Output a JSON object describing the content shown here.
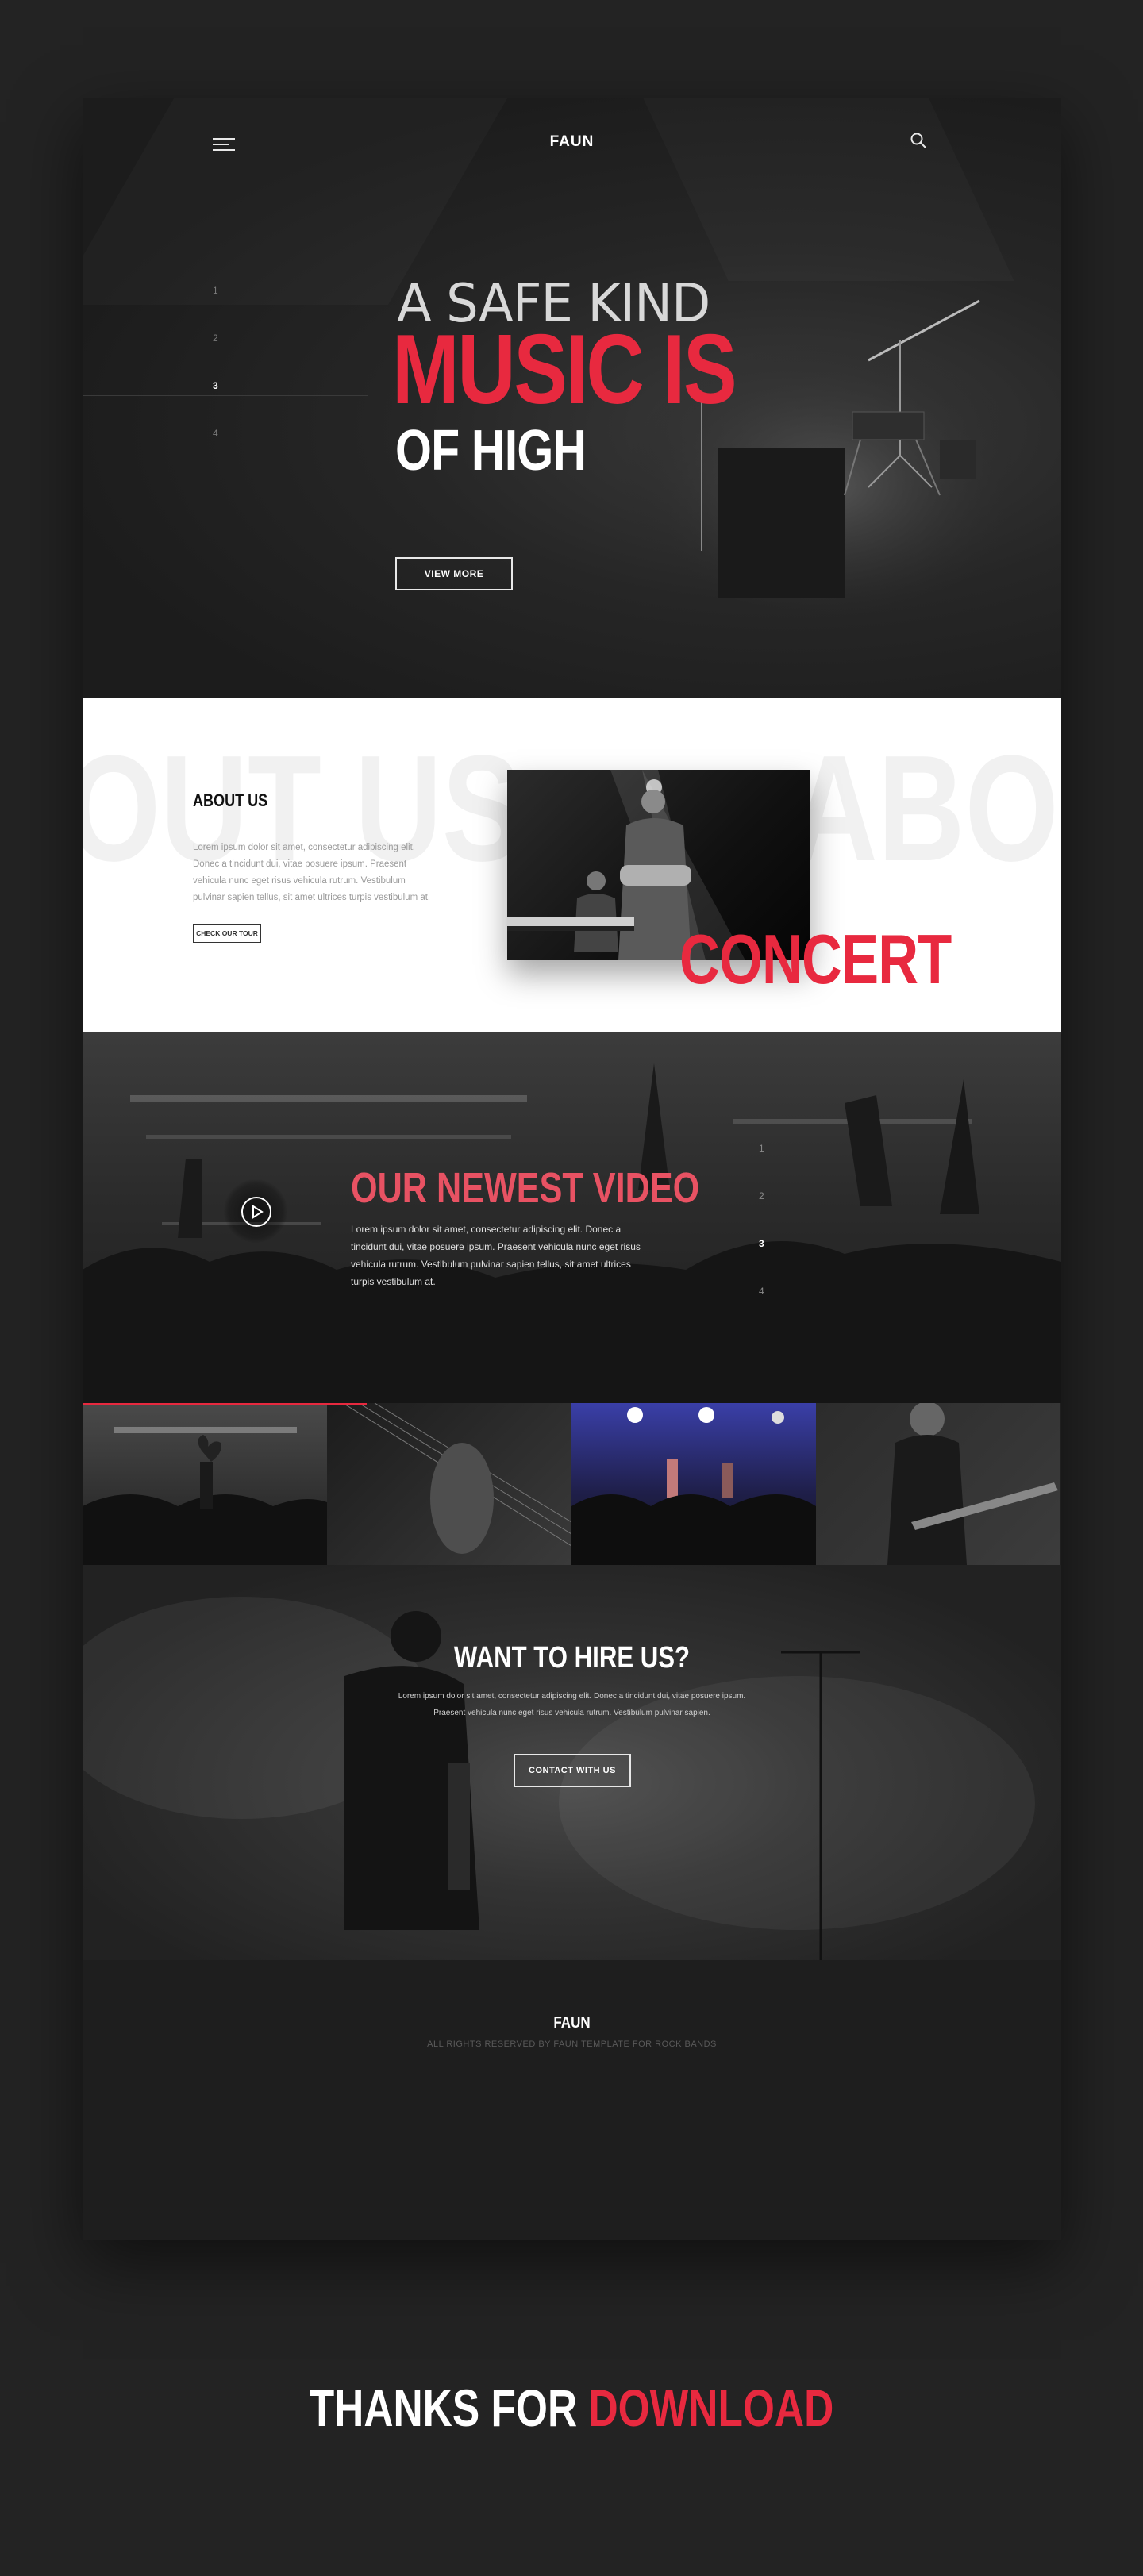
{
  "colors": {
    "accent": "#e8293f",
    "background": "#232323",
    "panel": "#1f1f1f"
  },
  "header": {
    "brand": "FAUN",
    "menu_icon": "hamburger-icon",
    "search_icon": "search-icon"
  },
  "hero": {
    "slides": [
      "1",
      "2",
      "3",
      "4"
    ],
    "active_slide": "3",
    "line1": "A SAFE KIND",
    "line2": "MUSIC IS",
    "line3": "OF HIGH",
    "button": "VIEW MORE"
  },
  "about": {
    "ghost_left": "OUT US",
    "ghost_right": "ABO",
    "title": "ABOUT US",
    "text": "Lorem ipsum dolor sit amet, consectetur adipiscing elit. Donec a tincidunt dui, vitae posuere ipsum. Praesent vehicula nunc eget risus vehicula rutrum. Vestibulum pulvinar sapien tellus, sit amet ultrices turpis vestibulum at.",
    "button": "CHECK OUR TOUR",
    "photo_label": "CONCERT"
  },
  "video": {
    "title": "OUR NEWEST VIDEO",
    "text": "Lorem ipsum dolor sit amet, consectetur adipiscing elit. Donec a tincidunt dui, vitae posuere ipsum. Praesent vehicula nunc eget risus vehicula rutrum. Vestibulum pulvinar sapien tellus, sit amet ultrices turpis vestibulum at.",
    "play_icon": "play-icon",
    "slides": [
      "1",
      "2",
      "3",
      "4"
    ],
    "active_slide": "3"
  },
  "gallery": {
    "progress": 0.29,
    "thumbs": [
      "crowd-heart-hands",
      "guitar-closeup",
      "blue-stage-crowd",
      "guitarist-performing"
    ]
  },
  "hire": {
    "title": "WANT TO HIRE US?",
    "text_line1": "Lorem ipsum dolor sit amet, consectetur adipiscing elit. Donec a tincidunt dui, vitae posuere ipsum.",
    "text_line2": "Praesent vehicula nunc eget risus vehicula rutrum. Vestibulum pulvinar sapien.",
    "button": "CONTACT WITH US"
  },
  "footer": {
    "brand": "FAUN",
    "copyright": "ALL RIGHTS RESERVED BY FAUN TEMPLATE FOR ROCK BANDS"
  },
  "thanks": {
    "part1": "THANKS FOR ",
    "part2": "DOWNLOAD"
  }
}
